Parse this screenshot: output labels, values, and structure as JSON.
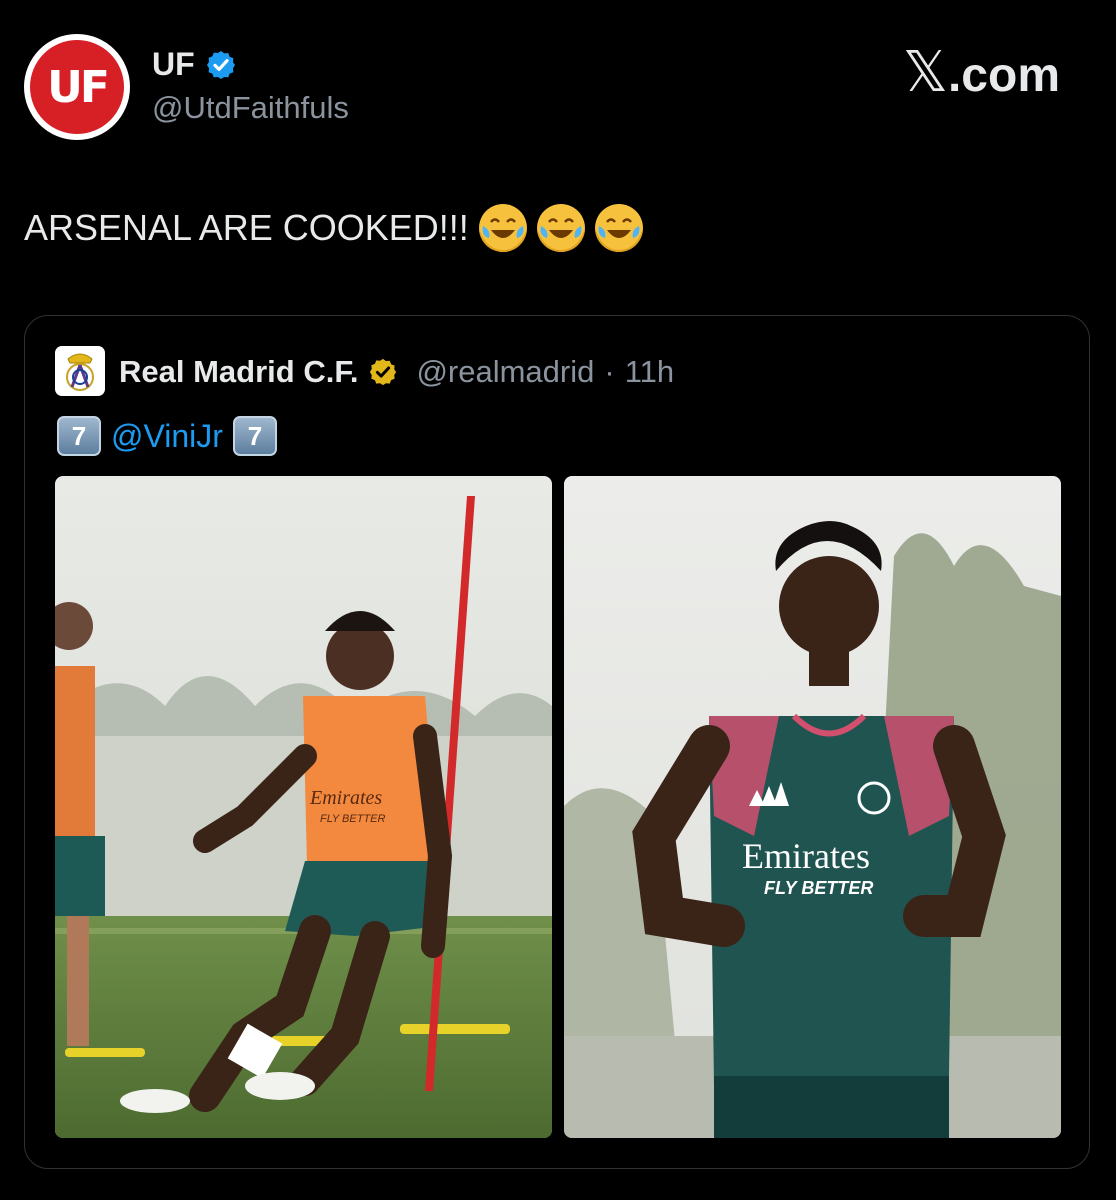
{
  "author": {
    "avatar_text": "UF",
    "name": "UF",
    "handle": "@UtdFaithfuls",
    "verified_color": "#1d9bf0"
  },
  "brand": {
    "logo_text": ".com",
    "logo_mark": "𝕏"
  },
  "post": {
    "text": "ARSENAL ARE COOKED!!!",
    "emojis": [
      "face-with-tears-of-joy",
      "face-with-tears-of-joy",
      "face-with-tears-of-joy"
    ]
  },
  "quoted": {
    "name": "Real Madrid C.F.",
    "handle": "@realmadrid",
    "separator": "·",
    "time": "11h",
    "verified_color": "#e2b719",
    "keycap_left": "7",
    "mention": "@ViniJr",
    "keycap_right": "7",
    "photos": [
      {
        "subject": "training-photo-bib-pole",
        "bib_text_1": "Emirates",
        "bib_text_2": "FLY BETTER"
      },
      {
        "subject": "training-photo-jog",
        "shirt_text_1": "Emirates",
        "shirt_text_2": "FLY BETTER"
      }
    ]
  },
  "colors": {
    "background": "#000000",
    "text_primary": "#e7e9ea",
    "text_secondary": "#8b949e",
    "border": "#2f3336",
    "accent_red": "#d71f26"
  }
}
